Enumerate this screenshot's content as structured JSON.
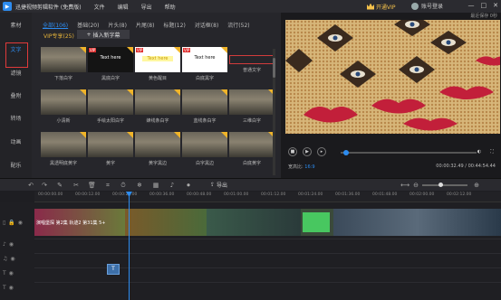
{
  "app": {
    "title": "迅捷视频剪辑软件 (免费版)",
    "menu": [
      "文件",
      "编辑",
      "导出",
      "帮助"
    ],
    "vip_label": "开通VIP",
    "login_label": "账号登录",
    "window_controls": [
      "—",
      "□",
      "✕"
    ]
  },
  "sidebar": {
    "items": [
      {
        "label": "素材",
        "active": false
      },
      {
        "label": "文字",
        "active": true
      },
      {
        "label": "滤镜",
        "active": false
      },
      {
        "label": "叠附",
        "active": false
      },
      {
        "label": "转场",
        "active": false
      },
      {
        "label": "动画",
        "active": false
      },
      {
        "label": "配乐",
        "active": false
      }
    ]
  },
  "library": {
    "tabs": [
      {
        "label": "全部(106)",
        "active": true
      },
      {
        "label": "基础(20)",
        "active": false
      },
      {
        "label": "片头(8)",
        "active": false
      },
      {
        "label": "片尾(8)",
        "active": false
      },
      {
        "label": "标题(12)",
        "active": false
      },
      {
        "label": "对话框(8)",
        "active": false
      },
      {
        "label": "流行(52)",
        "active": false
      }
    ],
    "vip_tab": "VIP专享(25)",
    "insert_button": "插入新字幕",
    "items": [
      {
        "caption": "下落白字",
        "style": "scene",
        "text": "",
        "vip": false,
        "corner": true
      },
      {
        "caption": "黑底白字",
        "style": "black",
        "text": "Text here",
        "vip": true,
        "corner": true
      },
      {
        "caption": "黄色醒目",
        "style": "yellow",
        "text": "Text here",
        "vip": true,
        "corner": true
      },
      {
        "caption": "白底黑字",
        "style": "white",
        "text": "Text here",
        "vip": true,
        "corner": true
      },
      {
        "caption": "普通文字",
        "style": "empty",
        "text": "",
        "vip": false,
        "corner": false
      },
      {
        "caption": "小清新",
        "style": "scene",
        "text": "",
        "vip": false,
        "corner": true
      },
      {
        "caption": "手绘太阳白字",
        "style": "scene",
        "text": "",
        "vip": false,
        "corner": true
      },
      {
        "caption": "蜂线条白字",
        "style": "scene",
        "text": "",
        "vip": false,
        "corner": true
      },
      {
        "caption": "蓝线条白字",
        "style": "scene",
        "text": "",
        "vip": false,
        "corner": true
      },
      {
        "caption": "三维白字",
        "style": "scene",
        "text": "",
        "vip": false,
        "corner": true
      },
      {
        "caption": "黑透明底黄字",
        "style": "scene",
        "text": "",
        "vip": false,
        "corner": true
      },
      {
        "caption": "黄字",
        "style": "scene",
        "text": "",
        "vip": false,
        "corner": true
      },
      {
        "caption": "黄字黑边",
        "style": "scene",
        "text": "",
        "vip": false,
        "corner": true
      },
      {
        "caption": "白字黑边",
        "style": "scene",
        "text": "",
        "vip": false,
        "corner": true
      },
      {
        "caption": "白底黄字",
        "style": "scene",
        "text": "",
        "vip": false,
        "corner": true
      }
    ]
  },
  "preview": {
    "label": "最近保存 0秒",
    "aspect_label": "宽高比:",
    "aspect_value": "16:9",
    "time_current": "00:00:32.49",
    "time_total": "00:44:54.44",
    "time_sep": " / ",
    "progress": 0.03
  },
  "toolbar": {
    "export_label": "导出"
  },
  "ruler": {
    "ticks": [
      "00:00:00.00",
      "00:00:12.00",
      "00:00:24.00",
      "00:00:36.00",
      "00:00:48.00",
      "00:01:00.00",
      "00:01:12.00",
      "00:01:24.00",
      "00:01:36.00",
      "00:01:48.00",
      "00:02:00.00",
      "00:02:12.00"
    ]
  },
  "timeline": {
    "clip_title": "演唱堡探 第2集 轨迹2 第31集 5+",
    "text_clip_label": "T"
  },
  "colors": {
    "accent": "#2d8cf0",
    "vip": "#f5c24b",
    "active_outline": "#e03a3a"
  }
}
